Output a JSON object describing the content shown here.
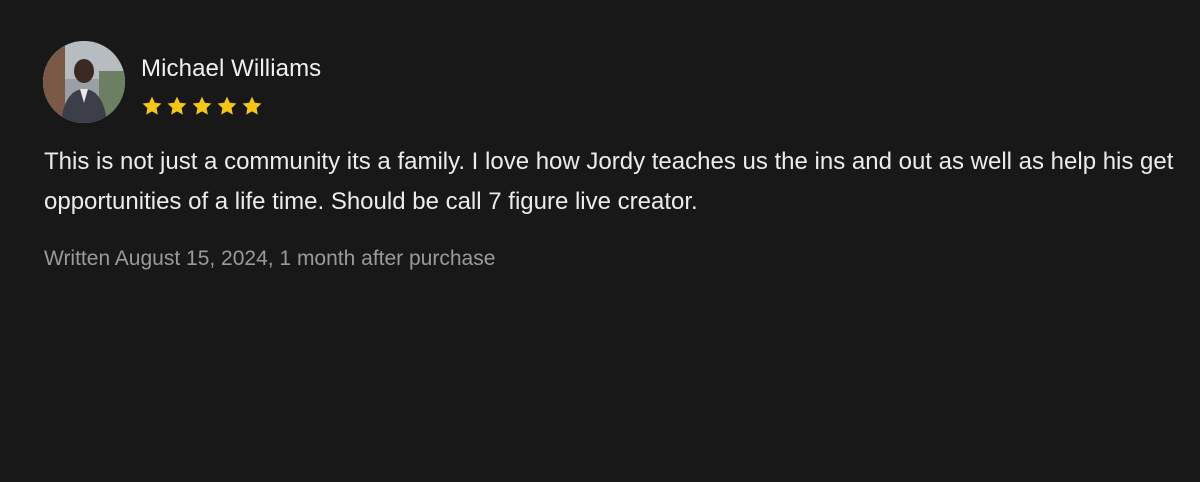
{
  "review": {
    "author": {
      "name": "Michael Williams",
      "avatar_icon": "user-avatar-photo"
    },
    "rating": {
      "value": 5,
      "max": 5,
      "star_color": "#f5c518"
    },
    "body": "This is not just a community its a family. I love how Jordy teaches us the ins and out as well as help his get opportunities of a life time. Should be call 7 figure live creator.",
    "meta": "Written August 15, 2024, 1 month after purchase"
  },
  "theme": {
    "background": "#181818",
    "text": "#ececec",
    "muted_text": "#9a9a9a"
  }
}
